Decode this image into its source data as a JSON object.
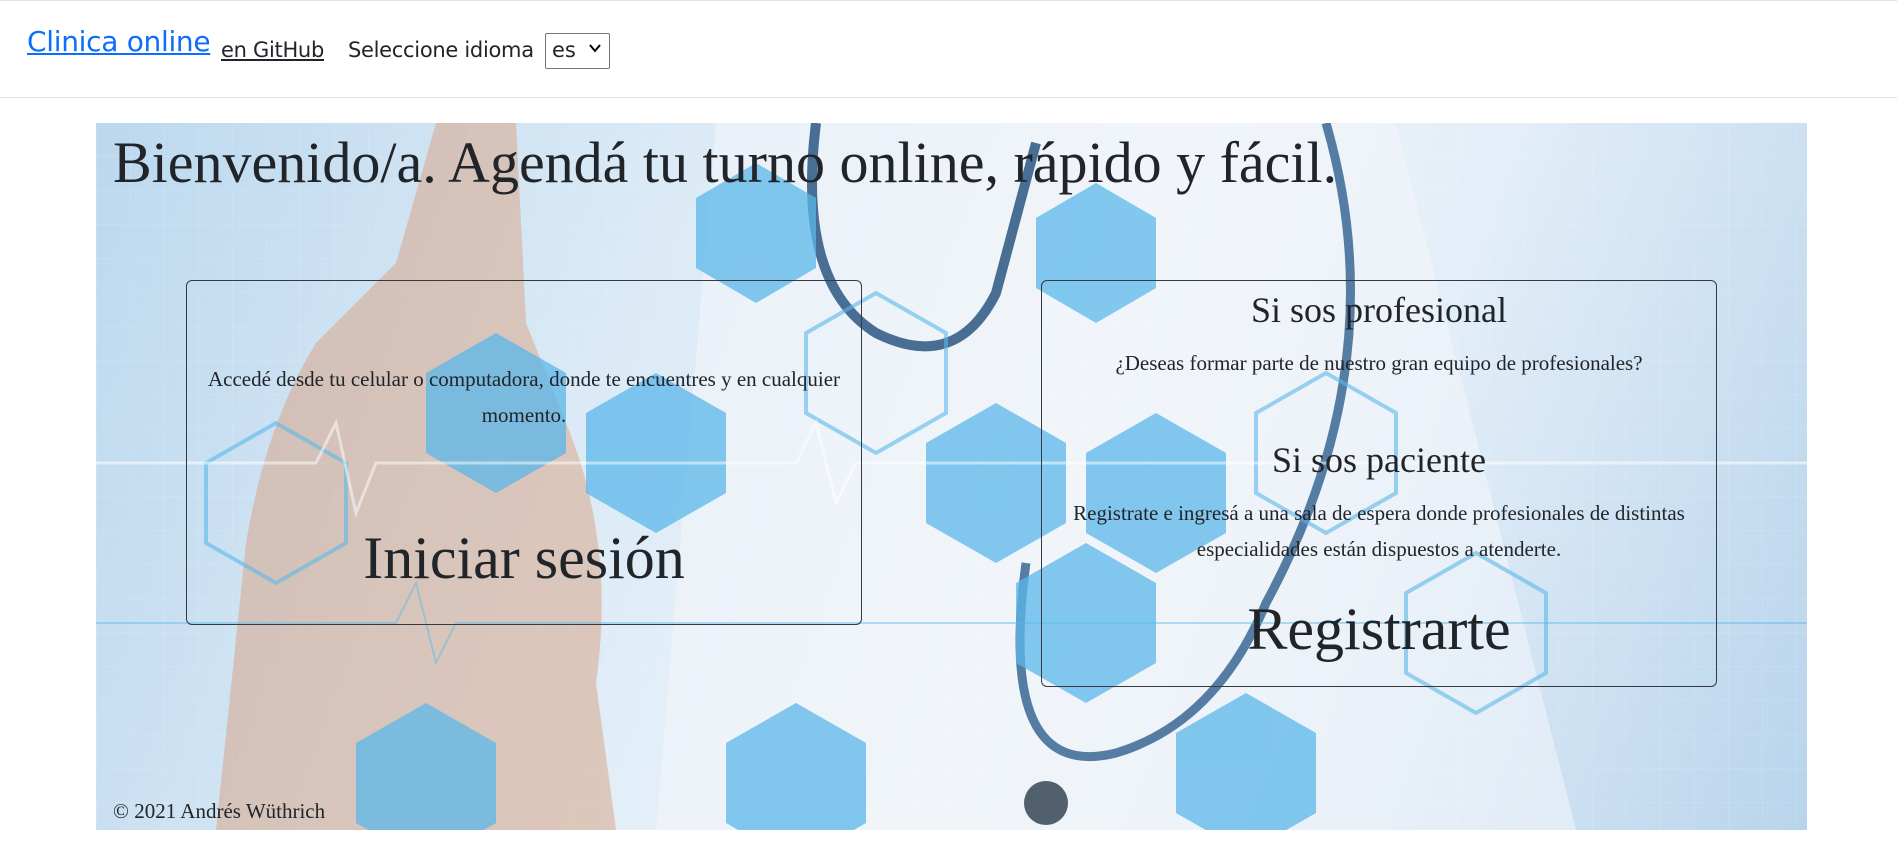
{
  "navbar": {
    "brand": "Clinica online",
    "github_link": "en GitHub",
    "language_label": "Seleccione idioma",
    "language_selected": "es"
  },
  "hero": {
    "title": "Bienvenido/a. Agendá tu turno online, rápido y fácil.",
    "login_card": {
      "description": "Accedé desde tu celular o computadora, donde te encuentres y en cualquier momento.",
      "button": "Iniciar sesión"
    },
    "register_card": {
      "professional_title": "Si sos profesional",
      "professional_text": "¿Deseas formar parte de nuestro gran equipo de profesionales?",
      "patient_title": "Si sos paciente",
      "patient_text": "Registrate e ingresá a una sala de espera donde profesionales de distintas especialidades están dispuestos a atenderte.",
      "button": "Registrarte"
    },
    "footer": "© 2021 Andrés Wüthrich"
  },
  "colors": {
    "link": "#0d6efd",
    "text": "#212529",
    "hero_accent": "#5bb7ea"
  }
}
